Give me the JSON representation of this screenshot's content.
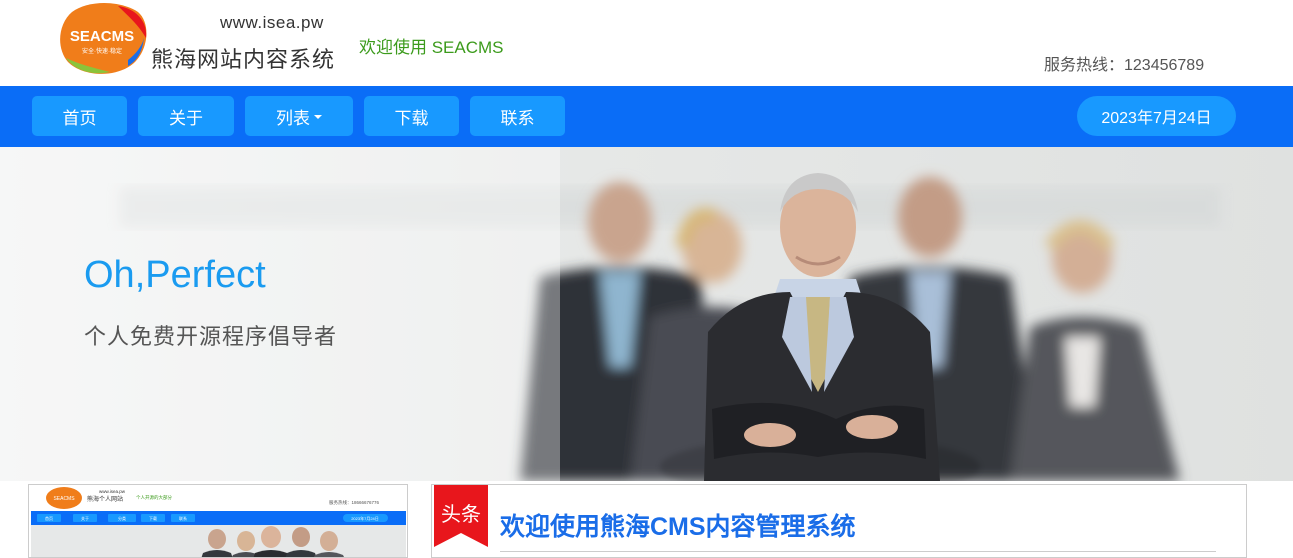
{
  "header": {
    "logo_badge_text": "SEACMS",
    "logo_badge_sub": "安全·快速·稳定",
    "logo_url": "www.isea.pw",
    "logo_name": "熊海网站内容系统",
    "welcome": "欢迎使用 SEACMS",
    "hotline": "服务热线：123456789"
  },
  "nav": {
    "items": [
      {
        "label": "首页"
      },
      {
        "label": "关于"
      },
      {
        "label": "列表"
      },
      {
        "label": "下载"
      },
      {
        "label": "联系"
      }
    ],
    "date": "2023年7月24日"
  },
  "banner": {
    "title": "Oh,Perfect",
    "subtitle": "个人免费开源程序倡导者"
  },
  "article": {
    "badge": "头条",
    "title": "欢迎使用熊海CMS内容管理系统"
  },
  "thumb": {
    "url": "www.isea.pw",
    "name": "熊海个人网站",
    "welcome": "个人开源的大部分",
    "hotline": "服务热线：18666676776",
    "nav": [
      "首页",
      "关于",
      "分类",
      "下载",
      "联系"
    ],
    "date": "2023年7月24日"
  },
  "colors": {
    "nav_bg": "#0a6df7",
    "nav_button": "#1899ff",
    "accent_green": "#3c9b1c",
    "banner_title": "#1a9bf0",
    "article_title": "#1a6de8",
    "ribbon_red": "#e8161c"
  }
}
